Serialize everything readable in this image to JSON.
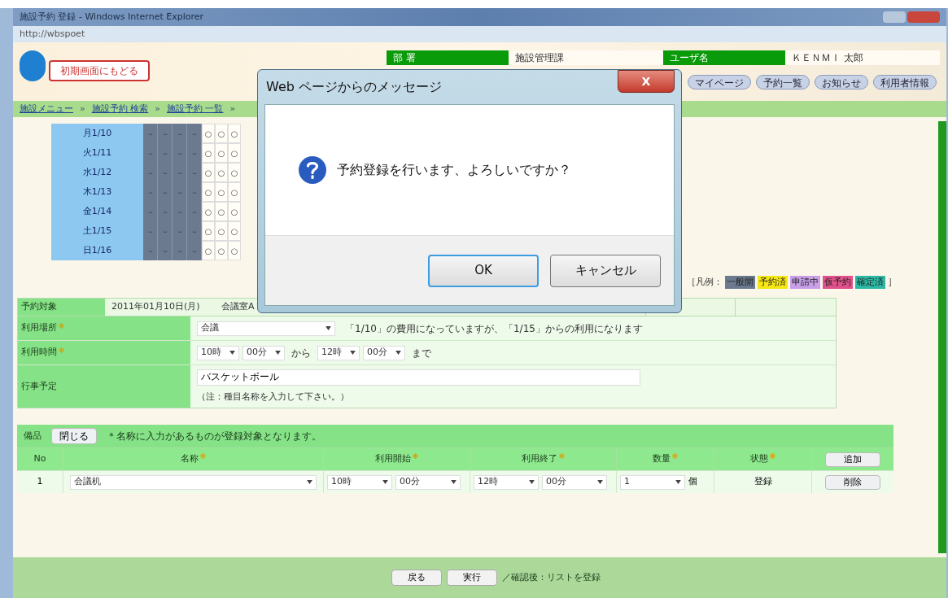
{
  "window": {
    "title": "施設予約 登録 - Windows Internet Explorer",
    "address": "http://wbspoet"
  },
  "header": {
    "home_button": "初期画面にもどる",
    "fields": [
      {
        "label": "部 署",
        "value": "施設管理課"
      },
      {
        "label": "ユーザ名",
        "value": "ＫＥＮＭＩ 太郎"
      }
    ],
    "buttons": [
      "マイページ",
      "予約一覧",
      "お知らせ",
      "利用者情報"
    ]
  },
  "breadcrumb": {
    "separator": "»",
    "items": [
      "施設メニュー",
      "施設予約 検索",
      "施設予約 一覧"
    ]
  },
  "calendar": {
    "rows": [
      {
        "date": "月1/10",
        "cells": [
          {
            "kind": "closed",
            "text": "－"
          },
          {
            "kind": "closed",
            "text": "－"
          },
          {
            "kind": "closed",
            "text": "－"
          },
          {
            "kind": "closed",
            "text": "－"
          },
          {
            "kind": "open",
            "text": "○"
          },
          {
            "kind": "open",
            "text": "○"
          },
          {
            "kind": "open",
            "text": "○"
          }
        ]
      },
      {
        "date": "火1/11",
        "cells": [
          {
            "kind": "closed",
            "text": "－"
          },
          {
            "kind": "closed",
            "text": "－"
          },
          {
            "kind": "closed",
            "text": "－"
          },
          {
            "kind": "closed",
            "text": "－"
          },
          {
            "kind": "open",
            "text": "○"
          },
          {
            "kind": "open",
            "text": "○"
          },
          {
            "kind": "open",
            "text": "○"
          }
        ]
      },
      {
        "date": "水1/12",
        "cells": [
          {
            "kind": "closed",
            "text": "－"
          },
          {
            "kind": "closed",
            "text": "－"
          },
          {
            "kind": "closed",
            "text": "－"
          },
          {
            "kind": "closed",
            "text": "－"
          },
          {
            "kind": "open",
            "text": "○"
          },
          {
            "kind": "open",
            "text": "○"
          },
          {
            "kind": "open",
            "text": "○"
          }
        ]
      },
      {
        "date": "木1/13",
        "cells": [
          {
            "kind": "closed",
            "text": "－"
          },
          {
            "kind": "closed",
            "text": "－"
          },
          {
            "kind": "closed",
            "text": "－"
          },
          {
            "kind": "closed",
            "text": "－"
          },
          {
            "kind": "open",
            "text": "○"
          },
          {
            "kind": "open",
            "text": "○"
          },
          {
            "kind": "open",
            "text": "○"
          }
        ]
      },
      {
        "date": "金1/14",
        "cells": [
          {
            "kind": "closed",
            "text": "－"
          },
          {
            "kind": "closed",
            "text": "－"
          },
          {
            "kind": "closed",
            "text": "－"
          },
          {
            "kind": "closed",
            "text": "－"
          },
          {
            "kind": "open",
            "text": "○"
          },
          {
            "kind": "open",
            "text": "○"
          },
          {
            "kind": "open",
            "text": "○"
          }
        ]
      },
      {
        "date": "土1/15",
        "cells": [
          {
            "kind": "closed",
            "text": "－"
          },
          {
            "kind": "closed",
            "text": "－"
          },
          {
            "kind": "closed",
            "text": "－"
          },
          {
            "kind": "closed",
            "text": "－"
          },
          {
            "kind": "open",
            "text": "○"
          },
          {
            "kind": "open",
            "text": "○"
          },
          {
            "kind": "open",
            "text": "○"
          }
        ]
      },
      {
        "date": "日1/16",
        "cells": [
          {
            "kind": "closed",
            "text": "－"
          },
          {
            "kind": "closed",
            "text": "－"
          },
          {
            "kind": "closed",
            "text": "－"
          },
          {
            "kind": "closed",
            "text": "－"
          },
          {
            "kind": "open",
            "text": "○"
          },
          {
            "kind": "open",
            "text": "○"
          },
          {
            "kind": "open",
            "text": "○"
          }
        ]
      }
    ],
    "legend": {
      "open": "［凡例：",
      "close": "］",
      "items": [
        {
          "label": "一般開",
          "color": "#6b7a8f"
        },
        {
          "label": "予約済",
          "color": "#f5e614"
        },
        {
          "label": "申請中",
          "color": "#c9a0e8"
        },
        {
          "label": "仮予約",
          "color": "#e0508a"
        },
        {
          "label": "確定済",
          "color": "#2cb8a4"
        }
      ]
    }
  },
  "form": {
    "target_label": "予約対象",
    "target_date": "2011年01月10日(月)",
    "target_place": "会議室A",
    "place": {
      "label": "利用場所",
      "required": true,
      "value": "会議",
      "note": "「1/10」の費用になっていますが、「1/15」からの利用になります"
    },
    "time": {
      "label": "利用時間",
      "required": true,
      "start_hour": "10時",
      "start_min": "00分",
      "from": "から",
      "end_hour": "12時",
      "end_min": "00分",
      "to": "まで"
    },
    "event": {
      "label": "行事予定",
      "value": "バスケットボール",
      "note": "（注：種目名称を入力して下さい。）"
    }
  },
  "equipment": {
    "title": "備品",
    "toggle": "閉じる",
    "note": "＊名称に入力があるものが登録対象となります。",
    "columns": [
      {
        "label": "No",
        "required": false
      },
      {
        "label": "名称",
        "required": true
      },
      {
        "label": "利用開始",
        "required": true
      },
      {
        "label": "利用終了",
        "required": true
      },
      {
        "label": "数量",
        "required": true
      },
      {
        "label": "状態",
        "required": true
      }
    ],
    "add_button": "追加",
    "rows": [
      {
        "no": "1",
        "name": "会議机",
        "start_hour": "10時",
        "start_min": "00分",
        "end_hour": "12時",
        "end_min": "00分",
        "qty": "1",
        "unit": "個",
        "state": "登録",
        "delete": "削除"
      }
    ]
  },
  "footer": {
    "back": "戻る",
    "submit": "実行",
    "note": "／確認後：リストを登録"
  },
  "dialog": {
    "title": "Web ページからのメッセージ",
    "close": "X",
    "message": "予約登録を行います、よろしいですか？",
    "buttons": [
      {
        "label": "OK",
        "selected": true
      },
      {
        "label": "キャンセル",
        "selected": false
      }
    ]
  }
}
